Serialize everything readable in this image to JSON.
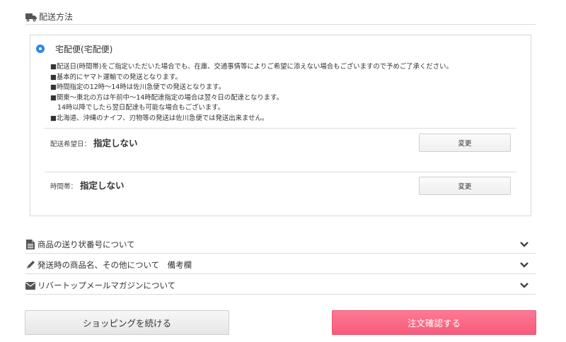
{
  "section": {
    "title": "配送方法",
    "icon": "truck-icon"
  },
  "shipping": {
    "method_label": "宅配便(宅配便)",
    "method_selected": true,
    "notes": [
      "■配送日(時間帯)をご指定いただいた場合でも、在庫、交通事情等によりご希望に添えない場合もございますので予めご了承ください。",
      "■基本的にヤマト運輸での発送となります。",
      "■時間指定の12時～14時は佐川急便での発送となります。",
      "■関東～東北の方は午前中～14時配達指定の場合は翌々日の配達となります。",
      "14時以降でしたら翌日配達も可能な場合もございます。",
      "■北海道、沖縄のナイフ、刃物等の発送は佐川急便では発送出来ません。"
    ],
    "delivery_date": {
      "label": "配送希望日：",
      "value": "指定しない",
      "button": "変更"
    },
    "time_slot": {
      "label": "時間帯：",
      "value": "指定しない",
      "button": "変更"
    }
  },
  "accordions": [
    {
      "label": "商品の送り状番号について",
      "icon": "document-icon"
    },
    {
      "label": "発送時の商品名、その他について　備考欄",
      "icon": "pencil-icon"
    },
    {
      "label": "リバートップメールマガジンについて",
      "icon": "envelope-icon"
    }
  ],
  "buttons": {
    "continue": "ショッピングを続ける",
    "confirm": "注文確認する"
  },
  "colors": {
    "accent": "#2b88e6",
    "confirm": "#f6627f"
  }
}
